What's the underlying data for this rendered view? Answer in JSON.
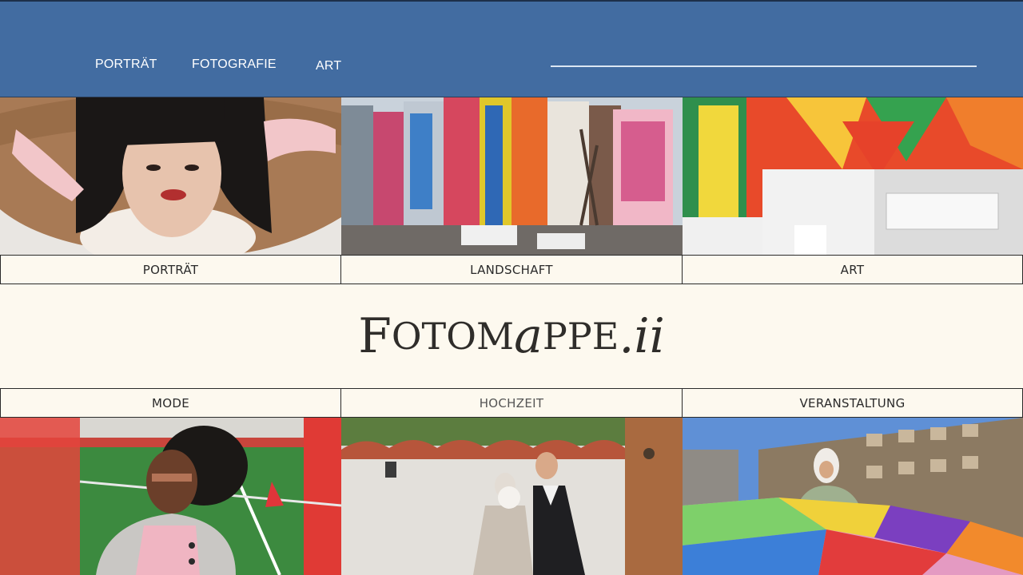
{
  "nav": {
    "items": [
      "PORTRÄT",
      "FOTOGRAFIE",
      "ART"
    ]
  },
  "gallery_top": {
    "labels": [
      "PORTRÄT",
      "LANDSCHAFT",
      "ART"
    ]
  },
  "brand": {
    "parts": [
      "F",
      "OTO",
      "M",
      "a",
      "PPE",
      ".ii"
    ]
  },
  "gallery_bottom": {
    "labels": [
      "MODE",
      "HOCHZEIT",
      "VERANSTALTUNG"
    ]
  },
  "colors": {
    "header": "#426ca1",
    "background": "#fdf9ef",
    "text": "#2a2a2a"
  }
}
